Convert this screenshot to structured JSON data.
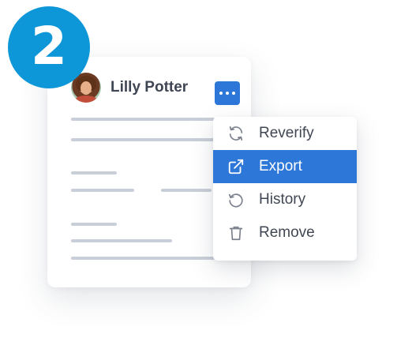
{
  "step": {
    "number": "2",
    "color": "#0d97d8"
  },
  "card": {
    "user_name": "Lilly Potter",
    "avatar_icon": "user-avatar",
    "more_button_icon": "more-dots-icon",
    "accent_color": "#2d77d9"
  },
  "menu": {
    "items": [
      {
        "label": "Reverify",
        "icon": "refresh-icon",
        "active": false
      },
      {
        "label": "Export",
        "icon": "external-link-icon",
        "active": true
      },
      {
        "label": "History",
        "icon": "history-icon",
        "active": false
      },
      {
        "label": "Remove",
        "icon": "trash-icon",
        "active": false
      }
    ]
  }
}
